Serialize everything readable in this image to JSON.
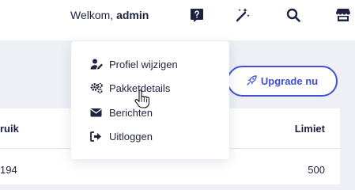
{
  "header": {
    "welcome_prefix": "Welkom, ",
    "username": "admin",
    "icons": [
      "help-chat-icon",
      "magic-wand-icon",
      "search-icon",
      "store-icon"
    ]
  },
  "user_menu": {
    "items": [
      {
        "label": "Profiel wijzigen",
        "icon": "user-edit-icon"
      },
      {
        "label": "Pakketdetails",
        "icon": "cogs-icon"
      },
      {
        "label": "Berichten",
        "icon": "envelope-icon"
      },
      {
        "label": "Uitloggen",
        "icon": "sign-out-icon"
      }
    ]
  },
  "upgrade_button": {
    "label": "Upgrade nu",
    "icon": "rocket-icon"
  },
  "usage_table": {
    "columns": [
      "ruik",
      "Limiet"
    ],
    "rows": [
      {
        "used": "194",
        "limit": "500"
      }
    ]
  },
  "colors": {
    "accent": "#3f51d6",
    "text": "#1d2240",
    "background": "#eef0f6"
  }
}
